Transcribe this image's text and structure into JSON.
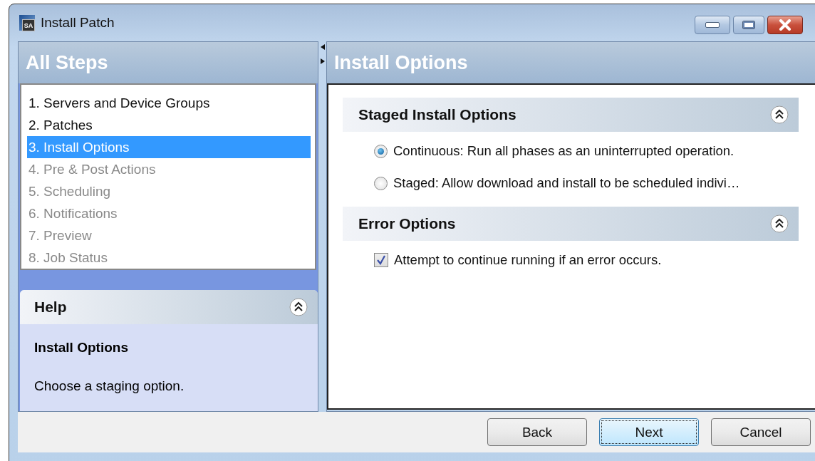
{
  "window": {
    "title": "Install Patch",
    "app_badge": "SA"
  },
  "steps_panel": {
    "title": "All Steps",
    "steps": [
      {
        "label": "1. Servers and Device Groups",
        "selected": false,
        "disabled": false
      },
      {
        "label": "2. Patches",
        "selected": false,
        "disabled": false
      },
      {
        "label": "3. Install Options",
        "selected": true,
        "disabled": false
      },
      {
        "label": "4. Pre & Post Actions",
        "selected": false,
        "disabled": true
      },
      {
        "label": "5. Scheduling",
        "selected": false,
        "disabled": true
      },
      {
        "label": "6. Notifications",
        "selected": false,
        "disabled": true
      },
      {
        "label": "7. Preview",
        "selected": false,
        "disabled": true
      },
      {
        "label": "8. Job Status",
        "selected": false,
        "disabled": true
      }
    ]
  },
  "help_panel": {
    "title": "Help",
    "heading": "Install Options",
    "text": "Choose a staging option.",
    "expanded": true
  },
  "main_panel": {
    "title": "Install Options",
    "sections": [
      {
        "title": "Staged Install Options",
        "expanded": true,
        "options": [
          {
            "kind": "radio",
            "label": "Continuous: Run all phases as an uninterrupted operation.",
            "selected": true
          },
          {
            "kind": "radio",
            "label": "Staged: Allow download and install to be scheduled indivi…",
            "selected": false
          }
        ]
      },
      {
        "title": "Error Options",
        "expanded": true,
        "options": [
          {
            "kind": "checkbox",
            "label": "Attempt to continue running if an error occurs.",
            "checked": true
          }
        ]
      }
    ]
  },
  "buttons": [
    {
      "label": "Back",
      "focused": false
    },
    {
      "label": "Next",
      "focused": true
    },
    {
      "label": "Cancel",
      "focused": false
    }
  ]
}
